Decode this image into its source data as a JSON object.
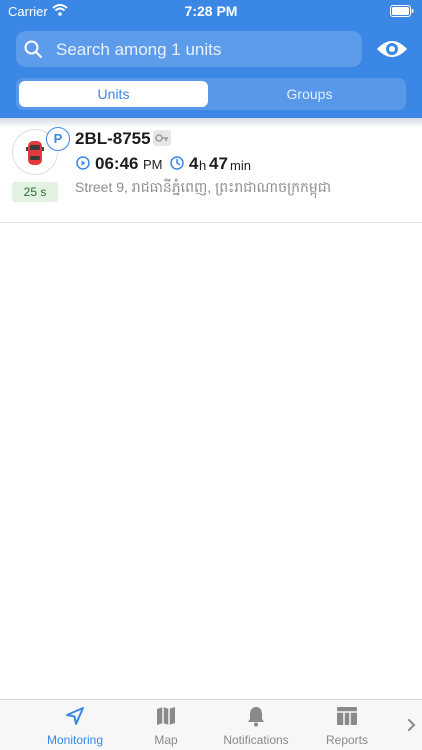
{
  "status_bar": {
    "carrier": "Carrier",
    "time": "7:28 PM"
  },
  "search": {
    "placeholder": "Search among 1 units"
  },
  "segments": {
    "units": "Units",
    "groups": "Groups",
    "selected": "Units"
  },
  "unit": {
    "parking_badge": "P",
    "age": "25 s",
    "name": "2BL-8755",
    "last_time": "06:46",
    "last_time_suffix": "PM",
    "duration_hours": "4",
    "duration_hours_unit": "h",
    "duration_minutes": "47",
    "duration_minutes_unit": "min",
    "address": "Street 9, រាជធានីភ្នំពេញ, ព្រះរាជាណាចក្រកម្ពុជា"
  },
  "tabs": [
    {
      "label": "Monitoring",
      "icon": "navigation-arrow-icon",
      "active": true
    },
    {
      "label": "Map",
      "icon": "map-icon",
      "active": false
    },
    {
      "label": "Notifications",
      "icon": "bell-icon",
      "active": false
    },
    {
      "label": "Reports",
      "icon": "reports-table-icon",
      "active": false
    }
  ],
  "colors": {
    "accent": "#3a87e6",
    "tab_inactive": "#8a8a8a",
    "age_badge_bg": "#e2f1e2"
  }
}
